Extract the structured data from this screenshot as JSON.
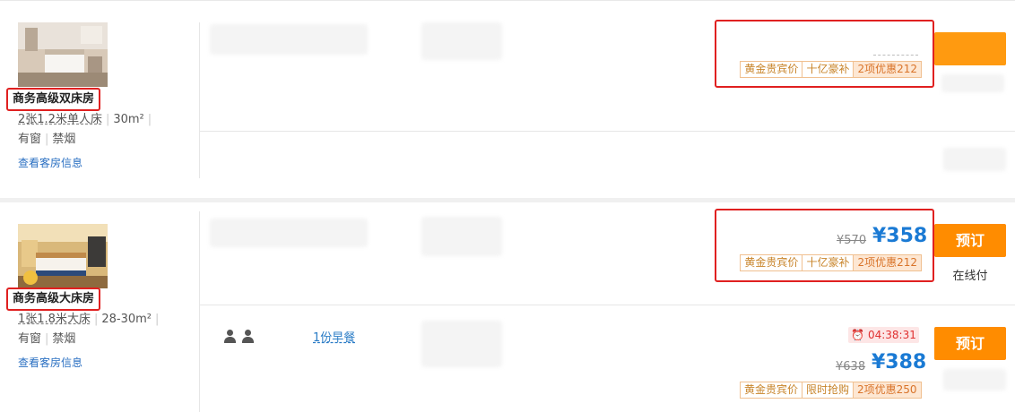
{
  "rooms": [
    {
      "name": "商务高级双床房",
      "bed": "2张1.2米单人床",
      "area": "30m²",
      "window": "有窗",
      "smoking": "禁烟",
      "link": "查看客房信息",
      "offers": [
        {
          "tags": [
            "黄金贵宾价",
            "十亿豪补"
          ],
          "promo": "2项优惠212"
        }
      ]
    },
    {
      "name": "商务高级大床房",
      "bed": "1张1.8米大床",
      "area": "28-30m²",
      "window": "有窗",
      "smoking": "禁烟",
      "link": "查看客房信息",
      "offers": [
        {
          "tags": [
            "黄金贵宾价",
            "十亿豪补"
          ],
          "promo": "2项优惠212",
          "original_price": "¥570",
          "price": "¥358",
          "book": "预订",
          "pay": "在线付"
        },
        {
          "breakfast": "1份早餐",
          "timer": "04:38:31",
          "original_price": "¥638",
          "price": "¥388",
          "tags": [
            "黄金贵宾价",
            "限时抢购"
          ],
          "promo": "2项优惠250",
          "book": "预订"
        }
      ]
    }
  ],
  "colors": {
    "accent_orange": "#ff8c00",
    "price_blue": "#1a7ad4",
    "highlight_red": "#e02020"
  }
}
